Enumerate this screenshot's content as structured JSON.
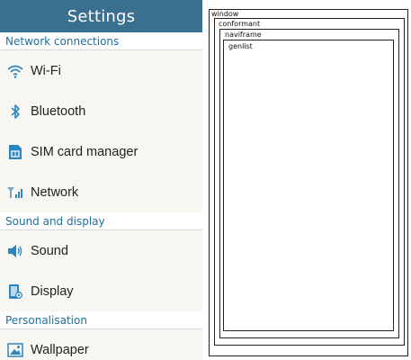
{
  "header": {
    "title": "Settings"
  },
  "sections": [
    {
      "title": "Network connections",
      "items": [
        {
          "label": "Wi-Fi",
          "icon": "wifi-icon"
        },
        {
          "label": "Bluetooth",
          "icon": "bluetooth-icon"
        },
        {
          "label": "SIM card manager",
          "icon": "sim-card-icon"
        },
        {
          "label": "Network",
          "icon": "network-signal-icon"
        }
      ]
    },
    {
      "title": "Sound and display",
      "items": [
        {
          "label": "Sound",
          "icon": "sound-icon"
        },
        {
          "label": "Display",
          "icon": "display-icon"
        }
      ]
    },
    {
      "title": "Personalisation",
      "items": [
        {
          "label": "Wallpaper",
          "icon": "wallpaper-icon"
        }
      ]
    }
  ],
  "diagram": {
    "labels": [
      "window",
      "conformant",
      "naviframe",
      "genlist"
    ]
  },
  "colors": {
    "titlebar": "#3a6f8f",
    "section_text": "#1f6f9a",
    "icon": "#2c86c4"
  }
}
